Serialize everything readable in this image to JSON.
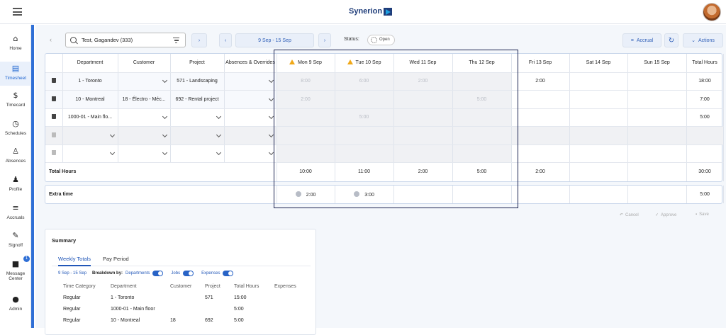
{
  "app": {
    "logo": "Synerion"
  },
  "sidebar": [
    {
      "label": "Home",
      "icon": "home-icon"
    },
    {
      "label": "Timesheet",
      "icon": "timesheet-icon"
    },
    {
      "label": "Timecard",
      "icon": "dollar-icon"
    },
    {
      "label": "Schedules",
      "icon": "clock-icon"
    },
    {
      "label": "Absences",
      "icon": "person-x-icon"
    },
    {
      "label": "Profile",
      "icon": "people-icon"
    },
    {
      "label": "Accruals",
      "icon": "accruals-icon"
    },
    {
      "label": "Signoff",
      "icon": "signoff-icon"
    },
    {
      "label": "Message Center",
      "icon": "chat-icon",
      "badge": "1"
    },
    {
      "label": "Admin",
      "icon": "admin-person-icon"
    }
  ],
  "toolbar": {
    "employee": "Test, Gagandev (333)",
    "week": "9 Sep - 15 Sep",
    "status_label": "Status:",
    "status_value": "Open",
    "accrual": "Accrual",
    "actions": "Actions"
  },
  "grid": {
    "headers": [
      "Department",
      "Customer",
      "Project",
      "Absences & Overrides",
      "Mon 9 Sep",
      "Tue 10 Sep",
      "Wed 11 Sep",
      "Thu 12 Sep",
      "Fri 13 Sep",
      "Sat 14 Sep",
      "Sun 15 Sep",
      "Total Hours"
    ],
    "rows": [
      {
        "dept": "1 - Toronto",
        "customer": "",
        "project": "571 - Landscaping",
        "days": [
          "8:00",
          "6:00",
          "2:00",
          "",
          "2:00",
          "",
          ""
        ],
        "total": "18:00"
      },
      {
        "dept": "10 - Montreal",
        "customer": "18 - Électro - Méc...",
        "project": "692 - Rental project",
        "days": [
          "2:00",
          "",
          "",
          "5:00",
          "",
          "",
          ""
        ],
        "total": "7:00"
      },
      {
        "dept": "1000-01 - Main flo...",
        "customer": "",
        "project": "",
        "days": [
          "",
          "5:00",
          "",
          "",
          "",
          "",
          ""
        ],
        "total": "5:00"
      },
      {
        "dept": "",
        "customer": "",
        "project": "",
        "days": [
          "",
          "",
          "",
          "",
          "",
          "",
          ""
        ],
        "total": ""
      },
      {
        "dept": "",
        "customer": "",
        "project": "",
        "days": [
          "",
          "",
          "",
          "",
          "",
          "",
          ""
        ],
        "total": ""
      }
    ],
    "total_label": "Total Hours",
    "totals": [
      "10:00",
      "11:00",
      "2:00",
      "5:00",
      "2:00",
      "",
      ""
    ],
    "grand_total": "30:00",
    "extra_label": "Extra time",
    "extra": [
      "2:00",
      "3:00",
      "",
      "",
      "",
      "",
      ""
    ],
    "extra_total": "5:00"
  },
  "row_actions": {
    "cancel": "Cancel",
    "approve": "Approve",
    "save": "Save"
  },
  "summary": {
    "title": "Summary",
    "tabs": [
      "Weekly Totals",
      "Pay Period"
    ],
    "range": "9 Sep - 15 Sep",
    "breakdown_label": "Breakdown by:",
    "toggles": [
      "Departments",
      "Jobs",
      "Expenses"
    ],
    "columns": [
      "Time Category",
      "Department",
      "Customer",
      "Project",
      "Total Hours",
      "Expenses"
    ],
    "rows": [
      [
        "Regular",
        "1 - Toronto",
        "",
        "571",
        "15:00",
        ""
      ],
      [
        "Regular",
        "1000-01 - Main floor",
        "",
        "",
        "5:00",
        ""
      ],
      [
        "Regular",
        "10 - Montreal",
        "18",
        "692",
        "5:00",
        ""
      ]
    ]
  }
}
